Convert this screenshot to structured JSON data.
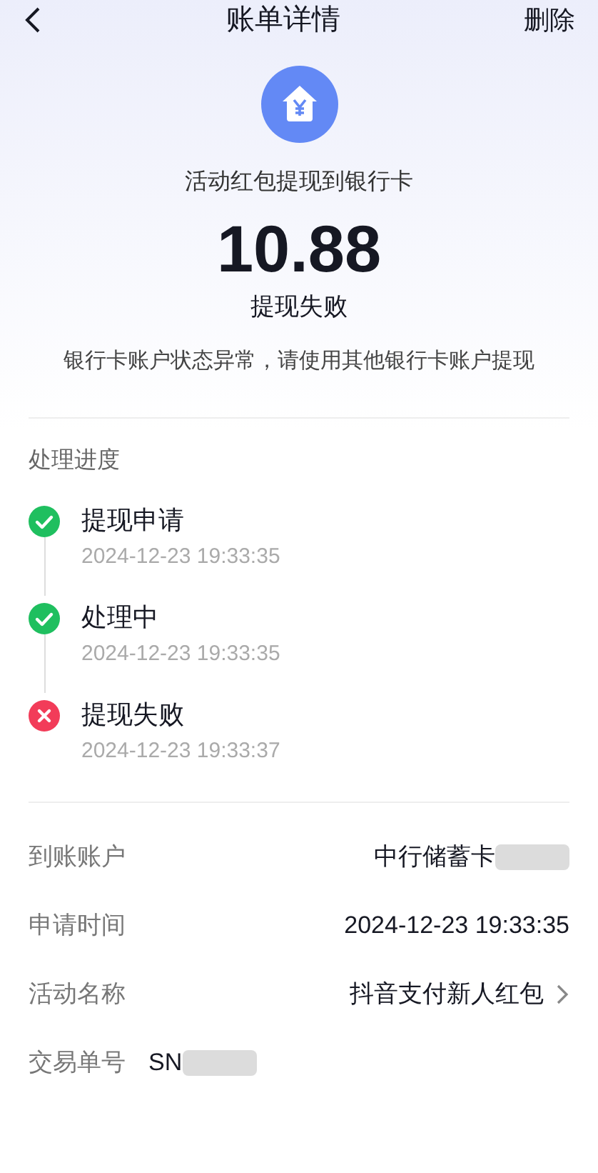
{
  "header": {
    "title": "账单详情",
    "action": "删除"
  },
  "summary": {
    "subtitle": "活动红包提现到银行卡",
    "amount": "10.88",
    "status": "提现失败",
    "message": "银行卡账户状态异常，请使用其他银行卡账户提现"
  },
  "progress": {
    "title": "处理进度",
    "steps": [
      {
        "label": "提现申请",
        "time": "2024-12-23 19:33:35",
        "kind": "done"
      },
      {
        "label": "处理中",
        "time": "2024-12-23 19:33:35",
        "kind": "done"
      },
      {
        "label": "提现失败",
        "time": "2024-12-23 19:33:37",
        "kind": "failed"
      }
    ]
  },
  "details": [
    {
      "kind": "field",
      "label": "到账账户",
      "value": "中行储蓄卡",
      "redacted": true,
      "link": false
    },
    {
      "kind": "field",
      "label": "申请时间",
      "value": "2024-12-23 19:33:35",
      "redacted": false,
      "link": false
    },
    {
      "kind": "field",
      "label": "活动名称",
      "value": "抖音支付新人红包",
      "redacted": false,
      "link": true
    },
    {
      "kind": "reference",
      "label": "交易单号",
      "value": "SN",
      "redacted": true,
      "link": false
    }
  ]
}
